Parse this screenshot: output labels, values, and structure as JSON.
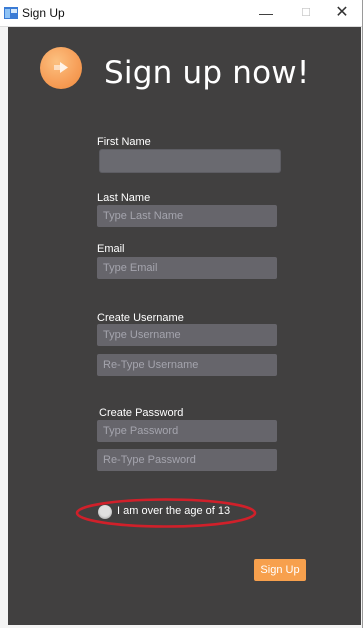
{
  "window": {
    "title": "Sign Up",
    "minimize_glyph": "—",
    "maximize_glyph": "☐",
    "close_glyph": "✕"
  },
  "header": {
    "heading": "Sign up now!",
    "logo_icon": "orange-circle-arrow-icon"
  },
  "form": {
    "first_name": {
      "label": "First Name",
      "value": "",
      "placeholder": ""
    },
    "last_name": {
      "label": "Last Name",
      "placeholder": "Type Last Name"
    },
    "email": {
      "label": "Email",
      "placeholder": "Type Email"
    },
    "username": {
      "label": "Create Username",
      "placeholder": "Type Username",
      "confirm_placeholder": "Re-Type Username"
    },
    "password": {
      "label": "Create Password",
      "placeholder": "Type Password",
      "confirm_placeholder": "Re-Type Password"
    },
    "age_check": {
      "label": "I am over the age of 13",
      "checked": false
    },
    "submit_label": "Sign Up"
  },
  "colors": {
    "background": "#414040",
    "field": "#66656b",
    "accent": "#f7a04d",
    "annotation": "#d0202a"
  }
}
